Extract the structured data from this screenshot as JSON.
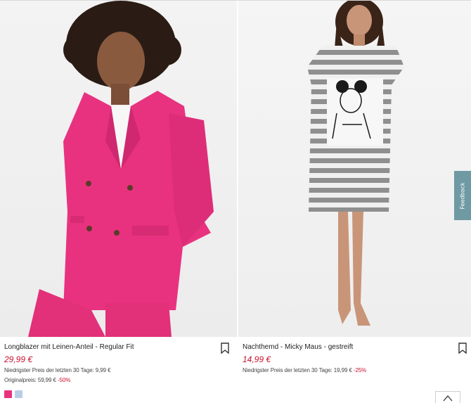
{
  "products": [
    {
      "title": "Longblazer mit Leinen-Anteil - Regular Fit",
      "price": "29,99 €",
      "lowest_price": "Niedrigster Preis der letzten 30 Tage: 9,99 €",
      "original_price": "Originalpreis: 59,99 €",
      "original_discount": "-50%",
      "swatches": [
        "#e8327f",
        "#b9cde6"
      ],
      "image": "pink-longblazer-photo"
    },
    {
      "title": "Nachthemd - Micky Maus - gestreift",
      "price": "14,99 €",
      "lowest_price": "Niedrigster Preis der letzten 30 Tage: 19,99 €",
      "lowest_discount": "-25%",
      "image": "striped-mickey-nightdress-photo"
    }
  ],
  "feedback_label": "Feedback",
  "colors": {
    "sale_red": "#c8102e",
    "feedback_tab": "#6f9aa3",
    "blazer_pink": "#e8327f"
  },
  "icons": {
    "bookmark": "bookmark-icon",
    "scroll_top": "arrow-up-icon"
  }
}
